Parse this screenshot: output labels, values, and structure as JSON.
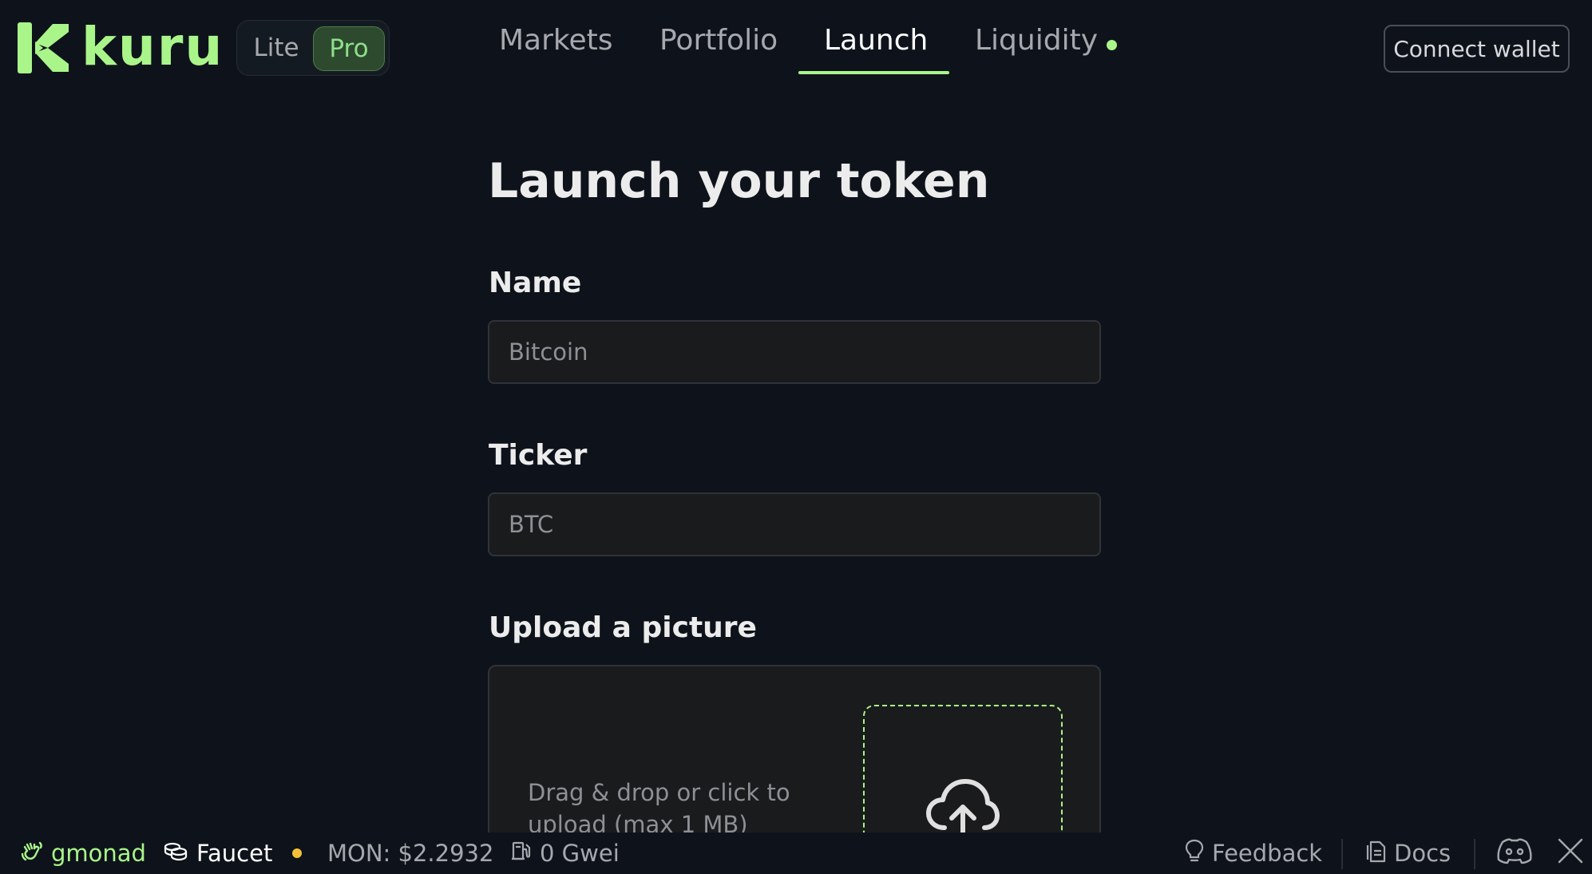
{
  "header": {
    "logo_text": "kuru",
    "mode_toggle": {
      "lite": "Lite",
      "pro": "Pro",
      "selected": "Pro"
    },
    "nav": [
      {
        "label": "Markets",
        "active": false
      },
      {
        "label": "Portfolio",
        "active": false
      },
      {
        "label": "Launch",
        "active": true
      },
      {
        "label": "Liquidity",
        "active": false,
        "has_indicator_dot": true
      }
    ],
    "connect_wallet": "Connect wallet"
  },
  "form": {
    "title": "Launch your token",
    "name": {
      "label": "Name",
      "placeholder": "Bitcoin",
      "value": ""
    },
    "ticker": {
      "label": "Ticker",
      "placeholder": "BTC",
      "value": ""
    },
    "upload": {
      "label": "Upload a picture",
      "hint": "Drag & drop or click to upload (max 1 MB)",
      "icon": "cloud-upload-icon"
    }
  },
  "footer": {
    "gmonad": "gmonad",
    "faucet": "Faucet",
    "mon_price": "MON: $2.2932",
    "gas": "0 Gwei",
    "feedback": "Feedback",
    "docs": "Docs"
  },
  "colors": {
    "background": "#0e131b",
    "accent": "#a9f58a",
    "status_dot": "#f5c035",
    "input_bg": "#1a1b1d"
  }
}
